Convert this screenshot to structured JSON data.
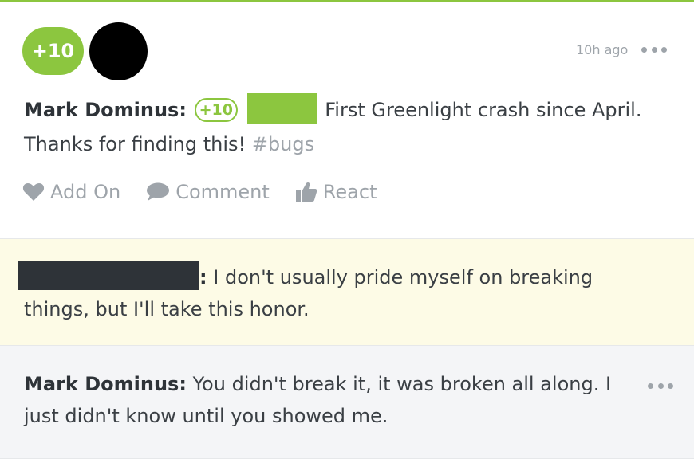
{
  "post": {
    "points_badge": "+10",
    "timestamp": "10h ago",
    "author": "Mark Dominus:",
    "inline_points": "+10",
    "text_line": "First Greenlight crash since April. Thanks for finding this!",
    "hashtag": "#bugs",
    "actions": {
      "add_on": "Add On",
      "comment": "Comment",
      "react": "React"
    }
  },
  "comments": [
    {
      "separator": ":",
      "text": "I don't usually pride myself on breaking things, but I'll take this honor."
    },
    {
      "author": "Mark Dominus:",
      "text": "You didn't break it, it was broken all along. I just didn't know until you showed me."
    }
  ],
  "colors": {
    "accent_green": "#8cc63f",
    "muted_gray": "#9ea4aa",
    "highlight_yellow": "#fdfbe6",
    "comment_gray": "#f4f5f7"
  },
  "icons": [
    "more-dots-icon",
    "heart-icon",
    "speech-bubble-icon",
    "thumbs-up-icon"
  ]
}
